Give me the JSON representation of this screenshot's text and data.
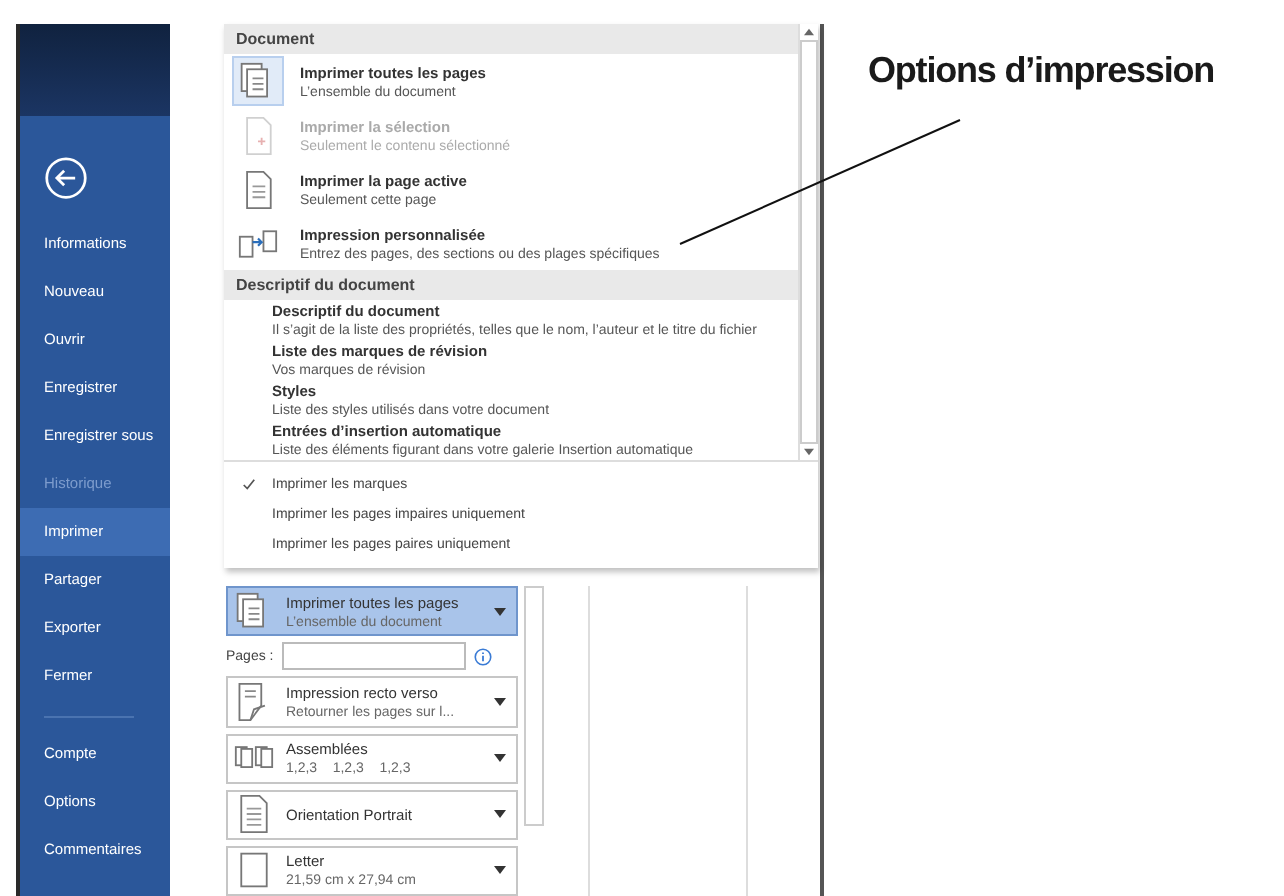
{
  "sidebar": {
    "items": [
      {
        "label": "Informations",
        "selected": false,
        "disabled": false
      },
      {
        "label": "Nouveau",
        "selected": false,
        "disabled": false
      },
      {
        "label": "Ouvrir",
        "selected": false,
        "disabled": false
      },
      {
        "label": "Enregistrer",
        "selected": false,
        "disabled": false
      },
      {
        "label": "Enregistrer sous",
        "selected": false,
        "disabled": false
      },
      {
        "label": "Historique",
        "selected": false,
        "disabled": true
      },
      {
        "label": "Imprimer",
        "selected": true,
        "disabled": false
      },
      {
        "label": "Partager",
        "selected": false,
        "disabled": false
      },
      {
        "label": "Exporter",
        "selected": false,
        "disabled": false
      },
      {
        "label": "Fermer",
        "selected": false,
        "disabled": false
      }
    ],
    "footer_items": [
      {
        "label": "Compte",
        "selected": false,
        "disabled": false
      },
      {
        "label": "Options",
        "selected": false,
        "disabled": false
      },
      {
        "label": "Commentaires",
        "selected": false,
        "disabled": false
      }
    ]
  },
  "print_menu": {
    "sections": [
      {
        "title": "Document",
        "options": [
          {
            "kind": "all-pages",
            "title": "Imprimer toutes les pages",
            "subtitle": "L’ensemble du document",
            "selected": true,
            "disabled": false
          },
          {
            "kind": "selection",
            "title": "Imprimer la sélection",
            "subtitle": "Seulement le contenu sélectionné",
            "selected": false,
            "disabled": true
          },
          {
            "kind": "page",
            "title": "Imprimer la page active",
            "subtitle": "Seulement cette page",
            "selected": false,
            "disabled": false
          },
          {
            "kind": "custom",
            "title": "Impression personnalisée",
            "subtitle": "Entrez des pages, des sections ou des plages spécifiques",
            "selected": false,
            "disabled": false
          }
        ]
      },
      {
        "title": "Descriptif du document",
        "options": [
          {
            "kind": "text",
            "title": "Descriptif du document",
            "subtitle": "Il s’agit de la liste des propriétés, telles que le nom, l’auteur et le titre du fichier",
            "selected": false,
            "disabled": false
          },
          {
            "kind": "text",
            "title": "Liste des marques de révision",
            "subtitle": "Vos marques de révision",
            "selected": false,
            "disabled": false
          },
          {
            "kind": "text",
            "title": "Styles",
            "subtitle": "Liste des styles utilisés dans votre document",
            "selected": false,
            "disabled": false
          },
          {
            "kind": "text",
            "title": "Entrées d’insertion automatique",
            "subtitle": "Liste des éléments figurant dans votre galerie Insertion automatique",
            "selected": false,
            "disabled": false
          }
        ]
      }
    ],
    "toggles": [
      {
        "label": "Imprimer les marques",
        "checked": true
      },
      {
        "label": "Imprimer les pages impaires uniquement",
        "checked": false
      },
      {
        "label": "Imprimer les pages paires uniquement",
        "checked": false
      }
    ]
  },
  "settings": {
    "range": {
      "title": "Imprimer toutes les pages",
      "subtitle": "L’ensemble du document",
      "selected": true
    },
    "pages_label": "Pages :",
    "dropdowns": [
      {
        "kind": "duplex",
        "title": "Impression recto verso",
        "subtitle": "Retourner les pages sur l...",
        "selected": false
      },
      {
        "kind": "collate",
        "title": "Assemblées",
        "subtitle": "1,2,3    1,2,3    1,2,3",
        "selected": false
      },
      {
        "kind": "orientation",
        "title": "Orientation Portrait",
        "selected": false
      },
      {
        "kind": "paper",
        "title": "Letter",
        "subtitle": "21,59 cm x 27,94 cm",
        "selected": false
      }
    ]
  },
  "callout": {
    "text": "Options d’impression"
  }
}
